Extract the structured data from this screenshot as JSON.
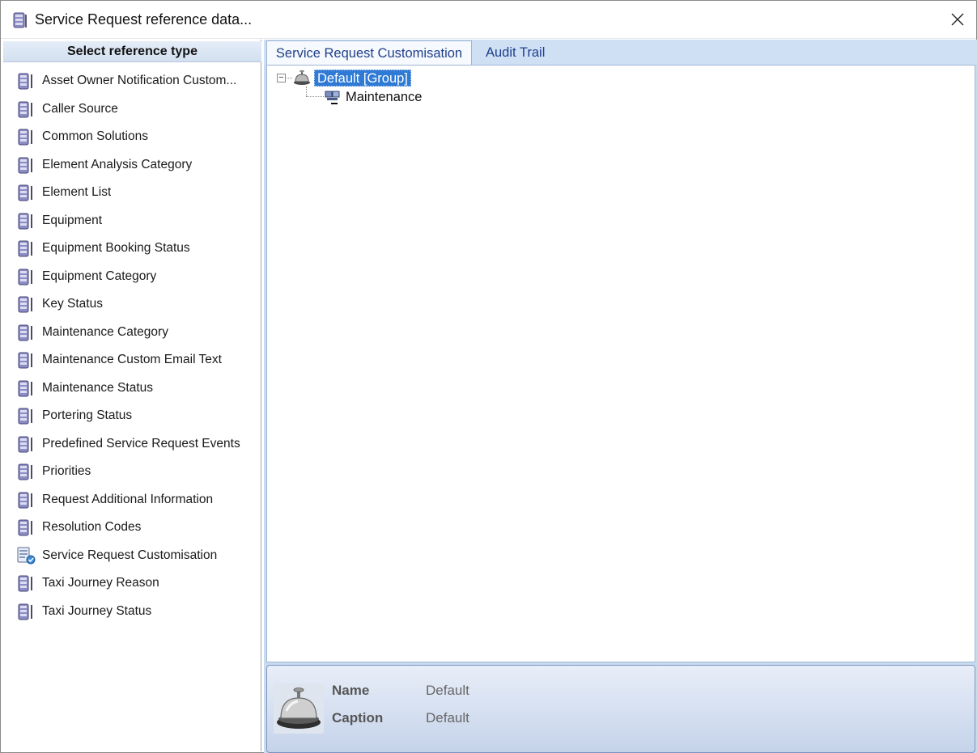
{
  "window": {
    "title": "Service Request reference data..."
  },
  "left_pane": {
    "header": "Select reference type",
    "items": [
      {
        "label": "Asset Owner Notification Custom...",
        "icon": "database-icon"
      },
      {
        "label": "Caller Source",
        "icon": "database-icon"
      },
      {
        "label": "Common Solutions",
        "icon": "database-icon"
      },
      {
        "label": "Element Analysis Category",
        "icon": "database-icon"
      },
      {
        "label": "Element List",
        "icon": "database-icon"
      },
      {
        "label": "Equipment",
        "icon": "database-icon"
      },
      {
        "label": "Equipment Booking Status",
        "icon": "database-icon"
      },
      {
        "label": "Equipment Category",
        "icon": "database-icon"
      },
      {
        "label": "Key Status",
        "icon": "database-icon"
      },
      {
        "label": "Maintenance Category",
        "icon": "database-icon"
      },
      {
        "label": "Maintenance Custom Email Text",
        "icon": "database-icon"
      },
      {
        "label": "Maintenance Status",
        "icon": "database-icon"
      },
      {
        "label": "Portering Status",
        "icon": "database-icon"
      },
      {
        "label": "Predefined Service Request Events",
        "icon": "database-icon"
      },
      {
        "label": "Priorities",
        "icon": "database-icon"
      },
      {
        "label": "Request Additional Information",
        "icon": "database-icon"
      },
      {
        "label": "Resolution Codes",
        "icon": "database-icon"
      },
      {
        "label": "Service Request Customisation",
        "icon": "customisation-icon"
      },
      {
        "label": "Taxi Journey Reason",
        "icon": "database-icon"
      },
      {
        "label": "Taxi Journey Status",
        "icon": "database-icon"
      }
    ]
  },
  "tabs": [
    {
      "label": "Service Request Customisation",
      "active": true
    },
    {
      "label": "Audit Trail",
      "active": false
    }
  ],
  "tree": {
    "root": {
      "label": "Default [Group]",
      "icon": "service-bell-icon",
      "expanded": true,
      "expander": "−"
    },
    "children": [
      {
        "label": "Maintenance",
        "icon": "maintenance-icon"
      }
    ]
  },
  "detail": {
    "icon": "service-bell-icon",
    "name_label": "Name",
    "name_value": "Default",
    "caption_label": "Caption",
    "caption_value": "Default"
  },
  "colors": {
    "selection": "#2f7ad5",
    "tab_text": "#1f3f8c",
    "pane_background": "#c9dbf1"
  }
}
